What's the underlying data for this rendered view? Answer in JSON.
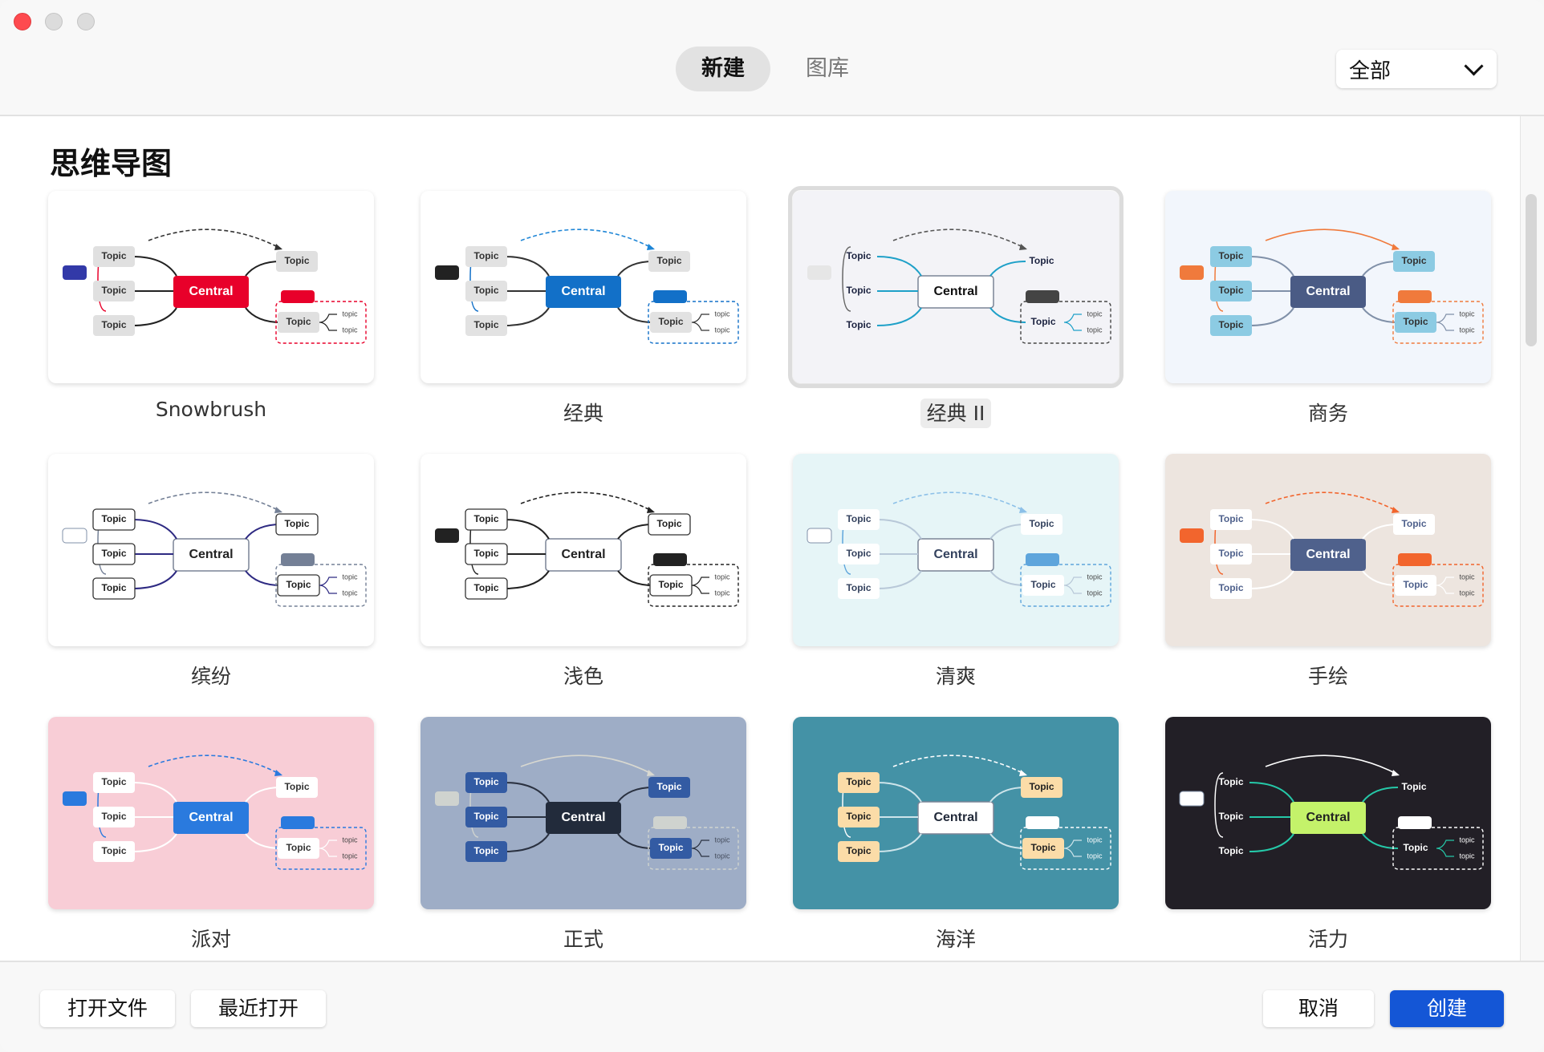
{
  "window": {
    "controls": [
      "close",
      "minimize",
      "maximize"
    ]
  },
  "header": {
    "tabs": [
      {
        "label": "新建",
        "active": true
      },
      {
        "label": "图库",
        "active": false
      }
    ],
    "filter": {
      "selected": "全部"
    }
  },
  "section": {
    "title": "思维导图"
  },
  "node_text": {
    "central": "Central",
    "topic": "Topic",
    "subtopic": "topic"
  },
  "templates": [
    {
      "name": "Snowbrush",
      "selected": false,
      "colors": {
        "bg": "#ffffff",
        "central": "#e8002a",
        "centralText": "#ffffff",
        "topic": "#e0e0e0",
        "topicText": "#333333",
        "line": "#222222",
        "accent": "#e8002a",
        "summary": "#3239a8",
        "relation": "#333333"
      }
    },
    {
      "name": "经典",
      "selected": false,
      "colors": {
        "bg": "#ffffff",
        "central": "#1270c8",
        "centralText": "#ffffff",
        "topic": "#e2e2e2",
        "topicText": "#333333",
        "line": "#333333",
        "accent": "#1270c8",
        "summary": "#222222",
        "relation": "#1f86d6"
      }
    },
    {
      "name": "经典 II",
      "selected": true,
      "colors": {
        "bg": "#f3f3f7",
        "central": "#ffffff",
        "centralText": "#111111",
        "topic": "none",
        "topicText": "#1c2340",
        "line": "#1ea0c8",
        "accent": "#444444",
        "summary": "#e6e6e6",
        "relation": "#555555"
      }
    },
    {
      "name": "商务",
      "selected": false,
      "colors": {
        "bg": "#f2f6fc",
        "central": "#4a5b85",
        "centralText": "#ffffff",
        "topic": "#8ccbe3",
        "topicText": "#333333",
        "line": "#8090a8",
        "accent": "#f07a3c",
        "summary": "#f07a3c",
        "relation": "#f07a3c"
      }
    },
    {
      "name": "缤纷",
      "selected": false,
      "colors": {
        "bg": "#ffffff",
        "central": "#ffffff",
        "centralText": "#222222",
        "topic": "#ffffff",
        "topicText": "#222222",
        "line": "#2e2a82",
        "accent": "#748096",
        "summary": "#ffffff",
        "relation": "#748096"
      }
    },
    {
      "name": "浅色",
      "selected": false,
      "colors": {
        "bg": "#ffffff",
        "central": "#ffffff",
        "centralText": "#222222",
        "topic": "#ffffff",
        "topicText": "#222222",
        "line": "#222222",
        "accent": "#222222",
        "summary": "#222222",
        "relation": "#222222"
      }
    },
    {
      "name": "清爽",
      "selected": false,
      "colors": {
        "bg": "#e6f5f7",
        "central": "#ffffff",
        "centralText": "#34425e",
        "topic": "#ffffff",
        "topicText": "#34425e",
        "line": "#b8c8d8",
        "accent": "#5ea5dc",
        "summary": "#ffffff",
        "relation": "#8cc0e8"
      }
    },
    {
      "name": "手绘",
      "selected": false,
      "colors": {
        "bg": "#ede5df",
        "central": "#4f618c",
        "centralText": "#ffffff",
        "topic": "#ffffff",
        "topicText": "#4f618c",
        "line": "#ffffff",
        "accent": "#f2652d",
        "summary": "#f2652d",
        "relation": "#f2652d"
      }
    },
    {
      "name": "派对",
      "selected": false,
      "colors": {
        "bg": "#f8cdd6",
        "central": "#2a7ade",
        "centralText": "#ffffff",
        "topic": "#ffffff",
        "topicText": "#333333",
        "line": "#ffffff",
        "accent": "#2a7ade",
        "summary": "#2a7ade",
        "relation": "#2a7ade"
      }
    },
    {
      "name": "正式",
      "selected": false,
      "colors": {
        "bg": "#9eadc6",
        "central": "#222b3b",
        "centralText": "#ffffff",
        "topic": "#335ba3",
        "topicText": "#ffffff",
        "line": "#2a3140",
        "accent": "#cfd3cf",
        "summary": "#cfd3cf",
        "relation": "#d8d8d0"
      }
    },
    {
      "name": "海洋",
      "selected": false,
      "colors": {
        "bg": "#4492a6",
        "central": "#ffffff",
        "centralText": "#222a3a",
        "topic": "#fbdca8",
        "topicText": "#222222",
        "line": "#cde4ea",
        "accent": "#ffffff",
        "summary": "#4492a6",
        "relation": "#ffffff"
      }
    },
    {
      "name": "活力",
      "selected": false,
      "colors": {
        "bg": "#221f26",
        "central": "#c4f26a",
        "centralText": "#222222",
        "topic": "none",
        "topicText": "#ffffff",
        "line": "#25c8a8",
        "accent": "#ffffff",
        "summary": "#ffffff",
        "relation": "#ffffff"
      }
    }
  ],
  "footer": {
    "open_file": "打开文件",
    "recent": "最近打开",
    "cancel": "取消",
    "create": "创建"
  }
}
